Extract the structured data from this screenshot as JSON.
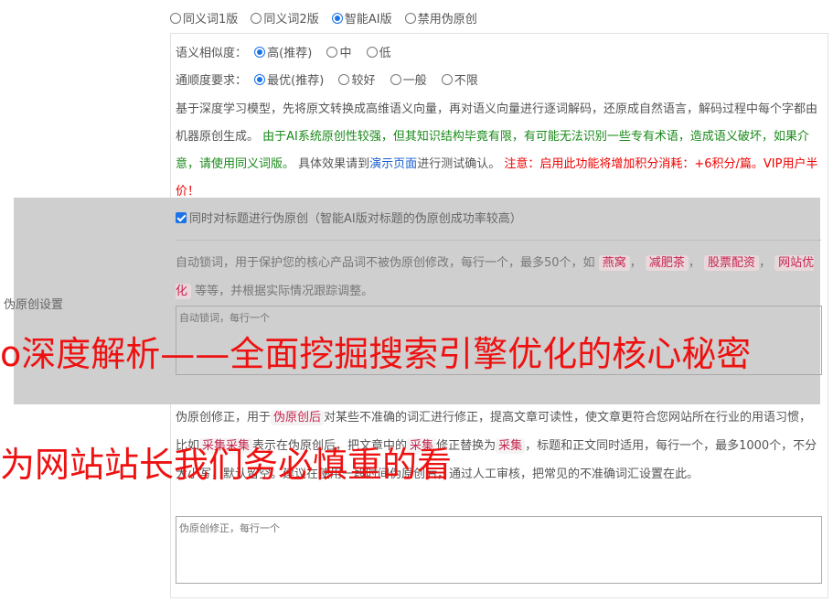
{
  "mode_options": [
    {
      "label": "同义词1版",
      "checked": false
    },
    {
      "label": "同义词2版",
      "checked": false
    },
    {
      "label": "智能AI版",
      "checked": true
    },
    {
      "label": "禁用伪原创",
      "checked": false
    }
  ],
  "similarity": {
    "label": "语义相似度：",
    "options": [
      {
        "label": "高(推荐)",
        "checked": true
      },
      {
        "label": "中",
        "checked": false
      },
      {
        "label": "低",
        "checked": false
      }
    ]
  },
  "fluency": {
    "label": "通顺度要求：",
    "options": [
      {
        "label": "最优(推荐)",
        "checked": true
      },
      {
        "label": "较好",
        "checked": false
      },
      {
        "label": "一般",
        "checked": false
      },
      {
        "label": "不限",
        "checked": false
      }
    ]
  },
  "description": {
    "part1": "基于深度学习模型，先将原文转换成高维语义向量，再对语义向量进行逐词解码，还原成自然语言，解码过程中每个字都由机器原创生成。",
    "part2_green": "由于AI系统原创性较强，但其知识结构毕竟有限，有可能无法识别一些专有术语，造成语义破坏，如果介意，请使用同义词版。",
    "part3": "具体效果请到",
    "link": "演示页面",
    "part4": "进行测试确认。",
    "part5_red": "注意：启用此功能将增加积分消耗：+6积分/篇。VIP用户半价！"
  },
  "side_label": "伪原创设置",
  "title_check": {
    "label": "同时对标题进行伪原创（智能AI版对标题的伪原创成功率较高）",
    "checked": true
  },
  "lock_words": {
    "desc_a": "自动锁词，用于保护您的核心产品词不被伪原创修改，每行一个，最多50个，如",
    "tags": [
      "燕窝",
      "减肥茶",
      "股票配资",
      "网站优化"
    ],
    "desc_b": "等等，并根据实际情况跟踪调整。",
    "placeholder": "自动锁词，每行一个"
  },
  "correction": {
    "desc_a": "伪原创修正，用于",
    "tag_a": "伪原创后",
    "desc_b": "对某些不准确的词汇进行修正，提高文章可读性，使文章更符合您网站所在行业的用语习惯，比如",
    "tag_b": "采集采集",
    "desc_c": "表示在伪原创后，把文章中的",
    "tag_c": "采集",
    "desc_d": "修正替换为",
    "tag_d": "采集",
    "desc_e": "，标题和正文同时适用，每行一个，最多1000个，不分大小写，默认留空。建议在使用一段时间伪原创后，通过人工审核，把常见的不准确词汇设置在此。",
    "placeholder": "伪原创修正，每行一个"
  },
  "overlay": {
    "line1": "o深度解析——全面挖掘搜索引擎优化的核心秘密",
    "line2": "为网站站长我们务必慎重的看"
  }
}
